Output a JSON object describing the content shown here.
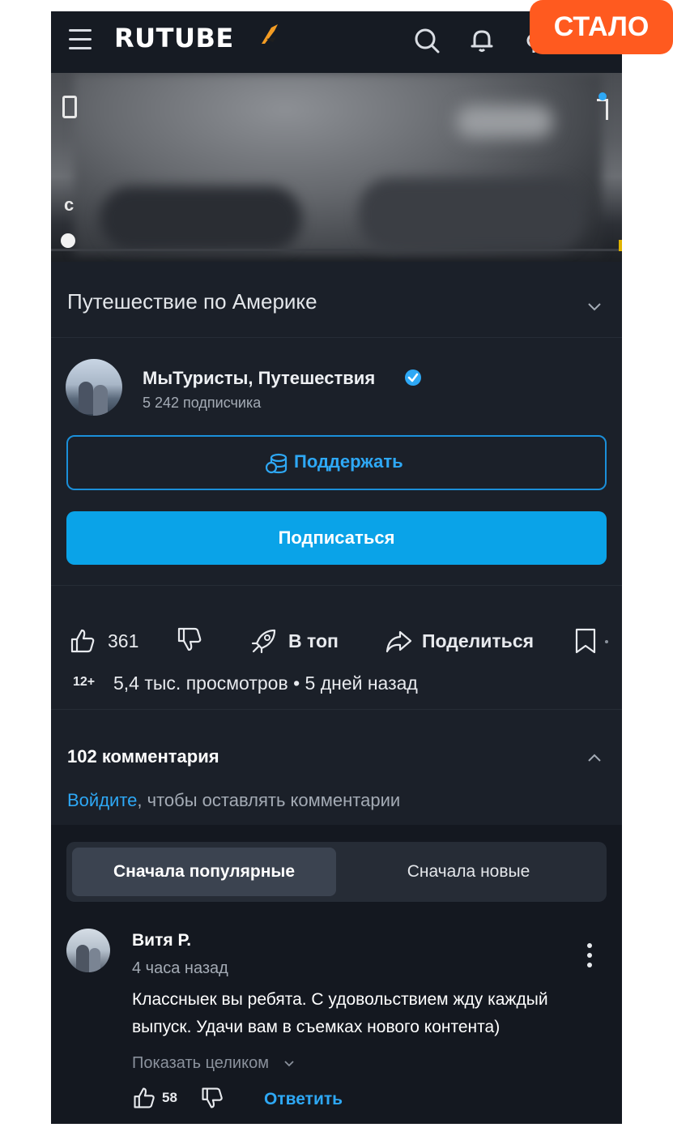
{
  "badge": {
    "label": "СТАЛО"
  },
  "header": {
    "logo": "RUTUBE"
  },
  "video": {
    "overlay_letter": "с"
  },
  "playlist": {
    "title": "Путешествие по Америке"
  },
  "channel": {
    "name": "МыТуристы, Путешествия",
    "subscribers": "5 242 подписчика",
    "support_label": "Поддержать",
    "subscribe_label": "Подписаться"
  },
  "actions": {
    "likes": "361",
    "top_label": "В топ",
    "share_label": "Поделиться"
  },
  "meta": {
    "age_rating": "12+",
    "views_date": "5,4 тыс. просмотров  •  5 дней назад"
  },
  "comments": {
    "count_label": "102 комментария",
    "login_link": "Войдите",
    "login_rest": ", чтобы оставлять комментарии",
    "sort_popular": "Сначала популярные",
    "sort_new": "Сначала новые",
    "items": [
      {
        "author": "Витя Р.",
        "time": "4 часа назад",
        "text": "Классныек вы ребята. С удовольствием жду каждый выпуск. Удачи вам в съемках нового контента)",
        "show_more": "Показать целиком",
        "likes": "58",
        "reply_label": "Ответить"
      }
    ]
  },
  "colors": {
    "background": "#1b2029",
    "accent": "#2ea8f5",
    "subscribe": "#0aa3e8",
    "badge": "#ff5a1f"
  }
}
